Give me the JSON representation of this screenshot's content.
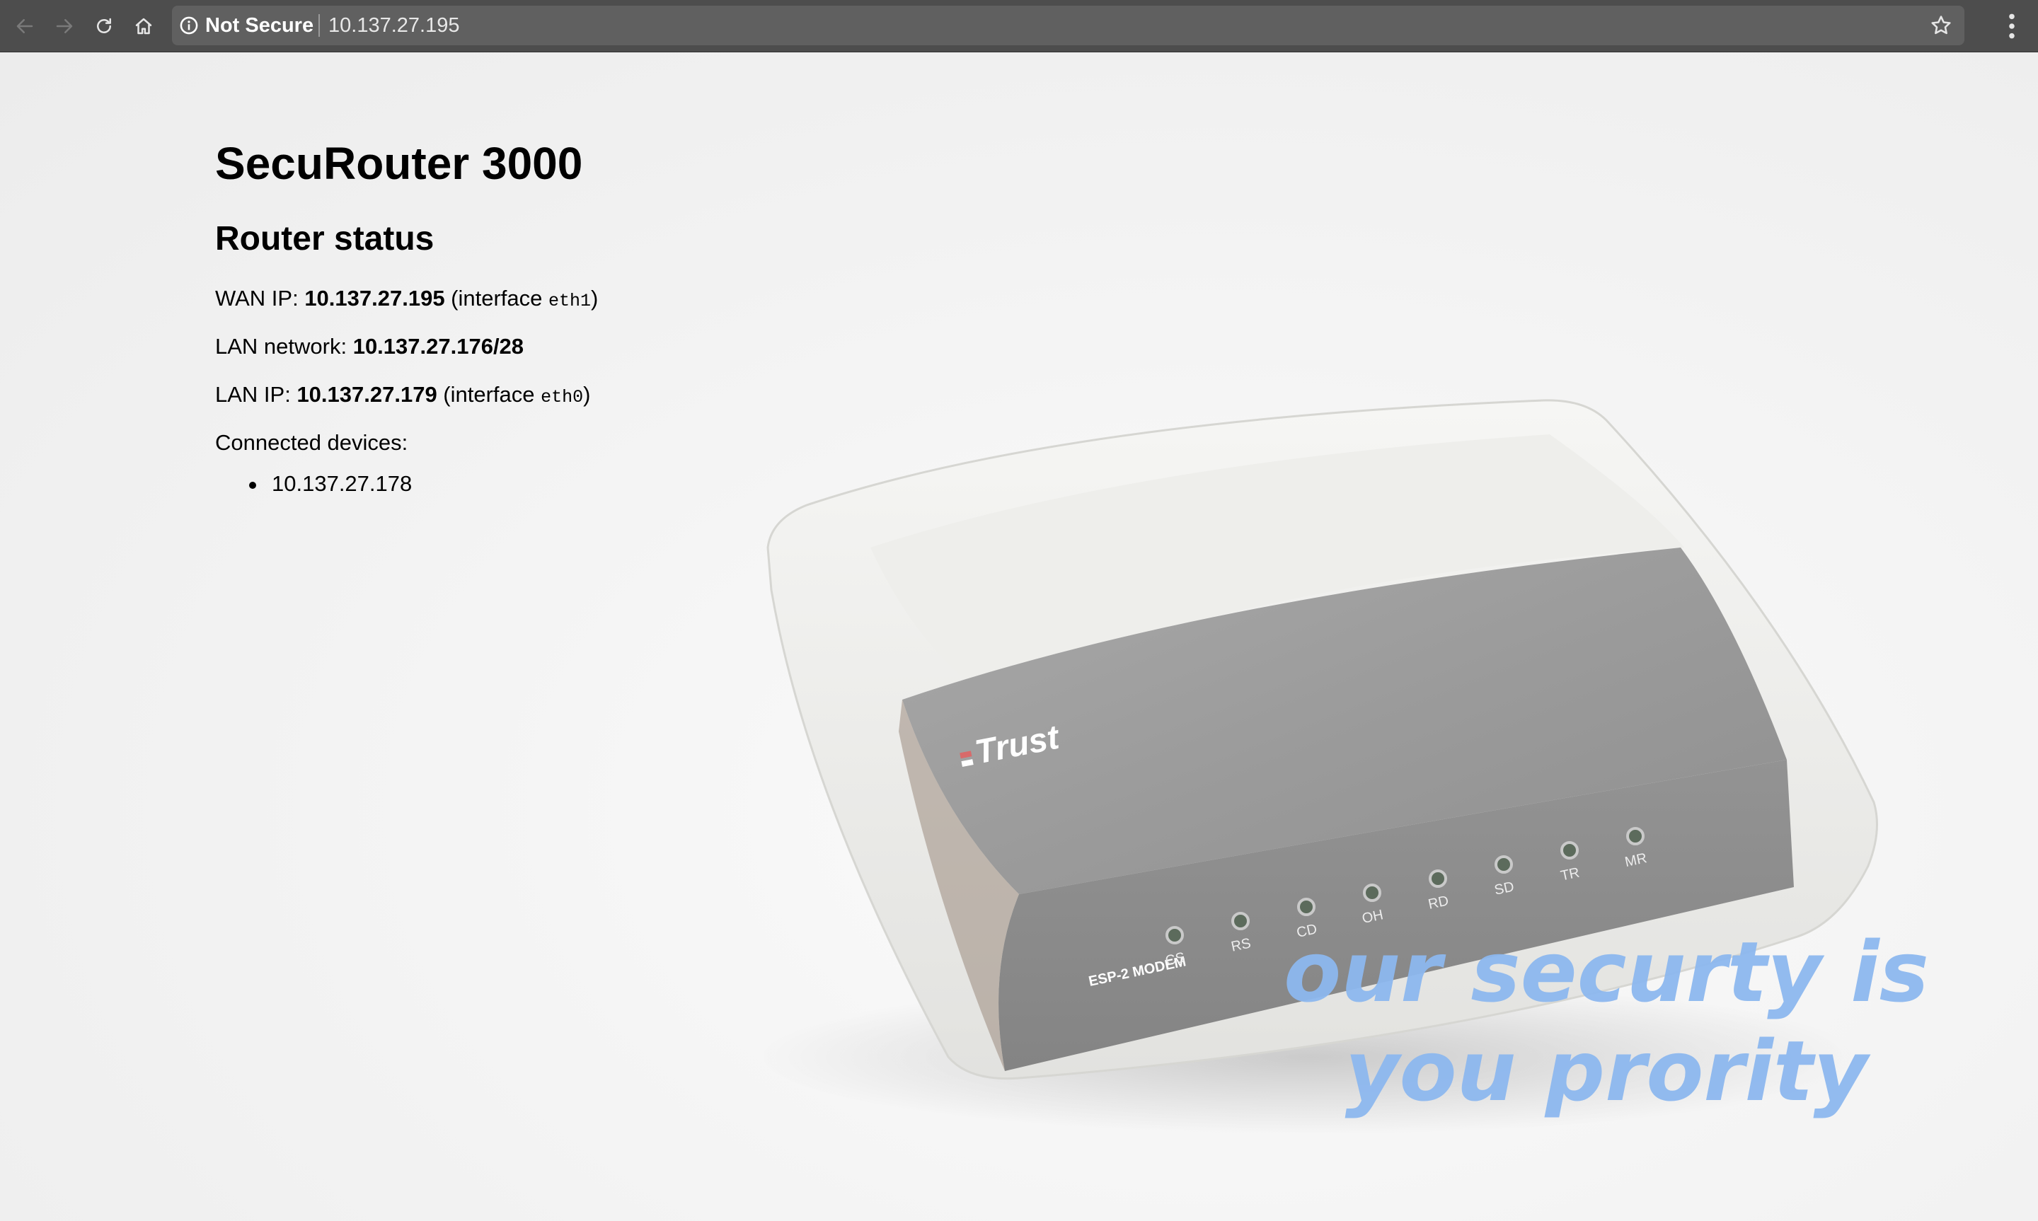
{
  "browser": {
    "security_label": "Not Secure",
    "url": "10.137.27.195"
  },
  "page": {
    "title": "SecuRouter 3000",
    "section_title": "Router status",
    "wan": {
      "label": "WAN IP: ",
      "ip": "10.137.27.195",
      "iface_prefix": " (interface ",
      "iface": "eth1",
      "iface_suffix": ")"
    },
    "lan_network": {
      "label": "LAN network: ",
      "value": "10.137.27.176/28"
    },
    "lan_ip": {
      "label": "LAN IP: ",
      "ip": "10.137.27.179",
      "iface_prefix": " (interface ",
      "iface": "eth0",
      "iface_suffix": ")"
    },
    "devices_label": "Connected devices:",
    "devices": [
      "10.137.27.178"
    ]
  },
  "hero": {
    "brand": "Trust",
    "model_label": "ESP-2 MODEM",
    "leds": [
      "CS",
      "RS",
      "CD",
      "OH",
      "RD",
      "SD",
      "TR",
      "MR"
    ],
    "slogan_line1": "our securty is",
    "slogan_line2": "you prority",
    "slogan_color": "#8db8ef"
  },
  "icons": {
    "back": "back-arrow-icon",
    "forward": "forward-arrow-icon",
    "reload": "reload-icon",
    "home": "home-icon",
    "security": "info-circle-icon",
    "bookmark": "star-icon",
    "menu": "vertical-dots-icon"
  }
}
